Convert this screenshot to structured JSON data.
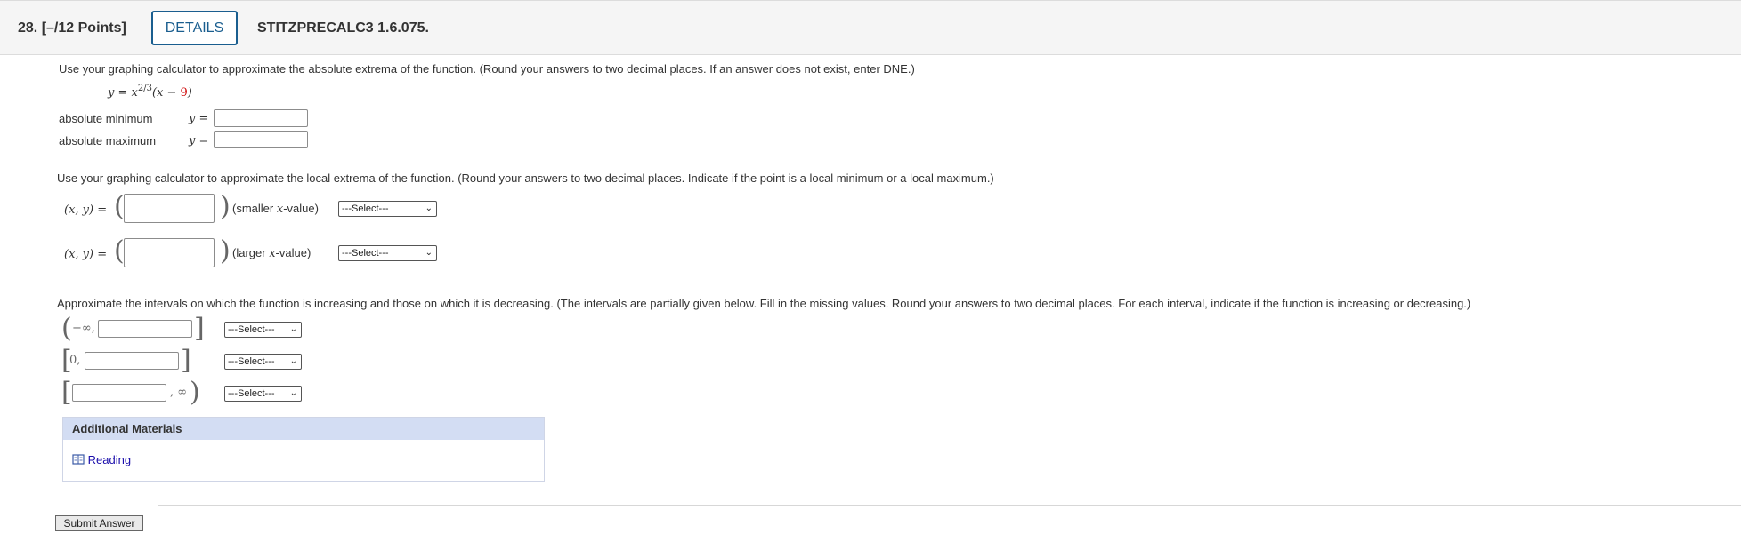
{
  "header": {
    "question_number": "28.",
    "points": "[–/12 Points]",
    "details_label": "DETAILS",
    "question_code": "STITZPRECALC3 1.6.075."
  },
  "part1": {
    "instructions": "Use your graphing calculator to approximate the absolute extrema of the function. (Round your answers to two decimal places. If an answer does not exist, enter DNE.)",
    "eq_lhs": "y = x",
    "eq_exp": "2/3",
    "eq_open": "(x − ",
    "eq_red": "9",
    "eq_close": ")",
    "abs_min_label": "absolute minimum",
    "abs_max_label": "absolute maximum",
    "y_eq": "y ="
  },
  "part2": {
    "instructions": "Use your graphing calculator to approximate the local extrema of the function. (Round your answers to two decimal places. Indicate if the point is a local minimum or a local maximum.)",
    "xy_label": "(x, y) =",
    "smaller_label_pre": "(smaller ",
    "smaller_label_x": "x",
    "smaller_label_post": "-value)",
    "larger_label_pre": "(larger ",
    "larger_label_x": "x",
    "larger_label_post": "-value)",
    "select_value": "---Select---"
  },
  "part3": {
    "instructions": "Approximate the intervals on which the function is increasing and those on which it is decreasing. (The intervals are partially given below. Fill in the missing values. Round your answers to two decimal places. For each interval, indicate if the function is increasing or decreasing.)",
    "row1_prefix": "−∞,",
    "row2_prefix": "0,",
    "row3_suffix": ", ∞",
    "select_value": "---Select---"
  },
  "additional_materials": {
    "title": "Additional Materials",
    "reading_label": "Reading",
    "link_color": "#1a0dab"
  },
  "submit_label": "Submit Answer",
  "colors": {
    "accent": "#1a5e8f",
    "am_header_bg": "#d3ddf3",
    "equation_red": "#cc0000"
  }
}
